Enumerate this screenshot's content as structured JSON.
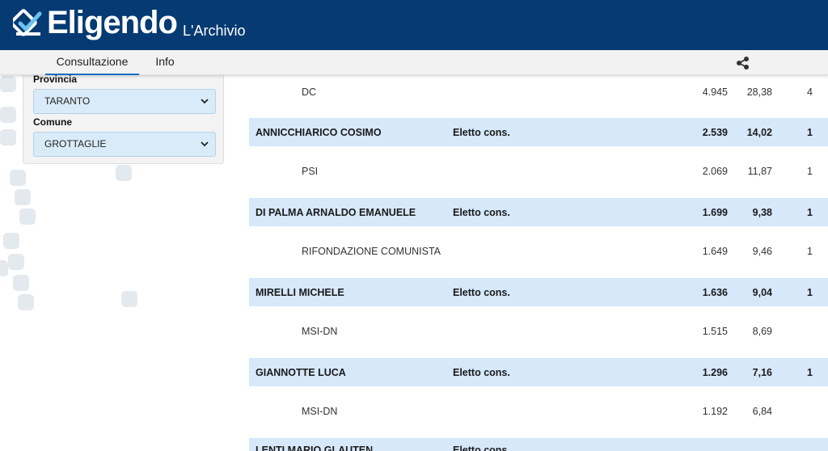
{
  "header": {
    "logo_text": "Eligendo",
    "subtitle": "L'Archivio",
    "brand_color": "#063a73"
  },
  "tabs": [
    {
      "label": "Consultazione",
      "active": true
    },
    {
      "label": "Info",
      "active": false
    }
  ],
  "share_icon": "share-icon",
  "filters": {
    "provincia_label": "Provincia",
    "provincia_value": "TARANTO",
    "comune_label": "Comune",
    "comune_value": "GROTTAGLIE"
  },
  "results": [
    {
      "type": "party",
      "name": "DC",
      "votes": "4.945",
      "pct": "28,38",
      "seats": "4"
    },
    {
      "type": "candidate",
      "name": "ANNICCHIARICO COSIMO",
      "status": "Eletto cons.",
      "votes": "2.539",
      "pct": "14,02",
      "seats": "1"
    },
    {
      "type": "party",
      "name": "PSI",
      "votes": "2.069",
      "pct": "11,87",
      "seats": "1"
    },
    {
      "type": "candidate",
      "name": "DI PALMA ARNALDO EMANUELE",
      "status": "Eletto cons.",
      "votes": "1.699",
      "pct": "9,38",
      "seats": "1"
    },
    {
      "type": "party",
      "name": "RIFONDAZIONE COMUNISTA",
      "votes": "1.649",
      "pct": "9,46",
      "seats": "1"
    },
    {
      "type": "candidate",
      "name": "MIRELLI MICHELE",
      "status": "Eletto cons.",
      "votes": "1.636",
      "pct": "9,04",
      "seats": "1"
    },
    {
      "type": "party",
      "name": "MSI-DN",
      "votes": "1.515",
      "pct": "8,69",
      "seats": ""
    },
    {
      "type": "candidate",
      "name": "GIANNOTTE LUCA",
      "status": "Eletto cons.",
      "votes": "1.296",
      "pct": "7,16",
      "seats": "1"
    },
    {
      "type": "party",
      "name": "MSI-DN",
      "votes": "1.192",
      "pct": "6,84",
      "seats": ""
    },
    {
      "type": "candidate",
      "name": "LENTI MARIO GLAUTEN",
      "status": "Eletto cons.",
      "votes": "",
      "pct": "",
      "seats": ""
    }
  ]
}
